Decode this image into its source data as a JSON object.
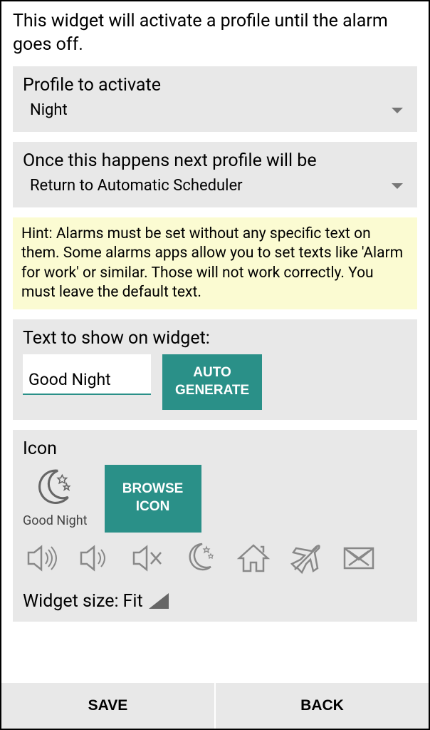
{
  "description": "This widget will activate a profile until the alarm goes off.",
  "profile": {
    "label": "Profile to activate",
    "value": "Night"
  },
  "next_profile": {
    "label": "Once this happens next profile will be",
    "value": "Return to Automatic Scheduler"
  },
  "hint": "Hint: Alarms must be set without any specific text on them. Some alarms apps allow you to set texts like 'Alarm for work' or similar. Those will not work correctly. You must leave the default text.",
  "widget_text": {
    "label": "Text to show on widget:",
    "value": "Good Night",
    "auto_generate_label": "AUTO GENERATE"
  },
  "icon": {
    "label": "Icon",
    "preview_label": "Good Night",
    "browse_label": "BROWSE ICON",
    "options": [
      {
        "name": "volume-full-icon"
      },
      {
        "name": "volume-mid-icon"
      },
      {
        "name": "volume-mute-icon"
      },
      {
        "name": "moon-icon"
      },
      {
        "name": "home-icon"
      },
      {
        "name": "airplane-icon"
      },
      {
        "name": "mail-blocked-icon"
      }
    ]
  },
  "widget_size": {
    "label": "Widget size: ",
    "value": "Fit"
  },
  "buttons": {
    "save": "SAVE",
    "back": "BACK"
  },
  "colors": {
    "accent": "#2a9088",
    "hint_bg": "#fbfbd2",
    "section_bg": "#e8e8e8"
  }
}
